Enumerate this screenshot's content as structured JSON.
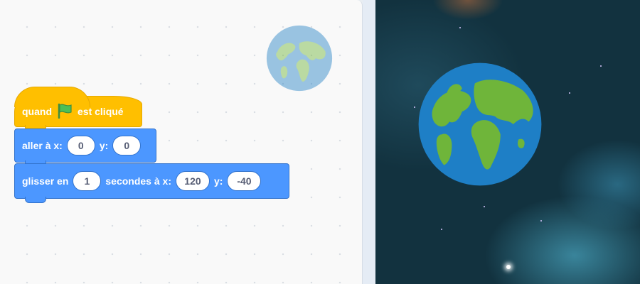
{
  "code_area": {
    "sprite_thumbnail_icon": "earth-icon",
    "blocks": {
      "when_flag": {
        "prefix": "quand",
        "flag_icon": "green-flag-icon",
        "suffix": "est cliqué"
      },
      "goto": {
        "label": "aller à x:",
        "x_value": "0",
        "y_label": "y:",
        "y_value": "0"
      },
      "glide": {
        "label": "glisser en",
        "secs_value": "1",
        "middle_label": "secondes à x:",
        "x_value": "120",
        "y_label": "y:",
        "y_value": "-40"
      }
    }
  },
  "stage": {
    "backdrop": "space-nebula",
    "sprite_icon": "earth-icon"
  },
  "colors": {
    "events": "#ffbf00",
    "motion": "#4c97ff",
    "flag": "#4cbf56"
  }
}
